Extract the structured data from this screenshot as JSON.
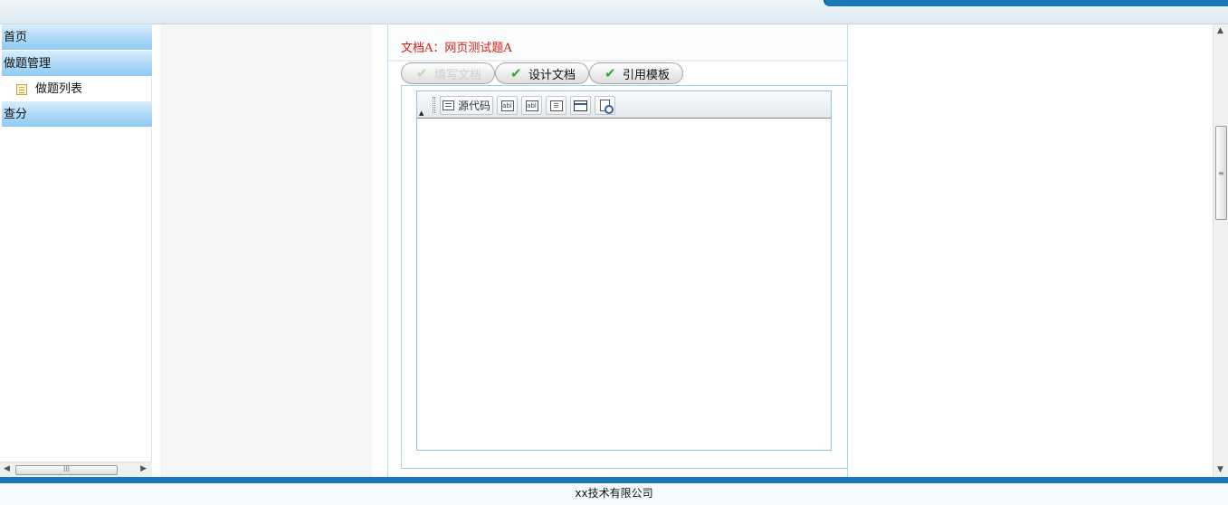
{
  "sidebar": {
    "groups": [
      {
        "label": "首页"
      },
      {
        "label": "做题管理",
        "items": [
          {
            "label": "做题列表",
            "icon": "list-icon"
          }
        ]
      },
      {
        "label": "查分"
      }
    ],
    "scrollbar_thumb_glyph": "III"
  },
  "document": {
    "title": "文档A：网页测试题A"
  },
  "tabs": [
    {
      "label": "填写文档",
      "state": "disabled",
      "icon": "check-icon"
    },
    {
      "label": "设计文档",
      "state": "enabled",
      "icon": "check-icon"
    },
    {
      "label": "引用模板",
      "state": "enabled",
      "icon": "check-icon"
    }
  ],
  "editor_toolbar": {
    "source_code_label": "源代码",
    "text_field_icon_text": "abl",
    "textarea_icon_text": "abl"
  },
  "footer": {
    "text": "xx技术有限公司"
  },
  "colors": {
    "accent_blue": "#1b78b8",
    "title_red": "#d31b14",
    "check_green": "#3aa33a",
    "menu_blue": "#a9d6f6"
  }
}
